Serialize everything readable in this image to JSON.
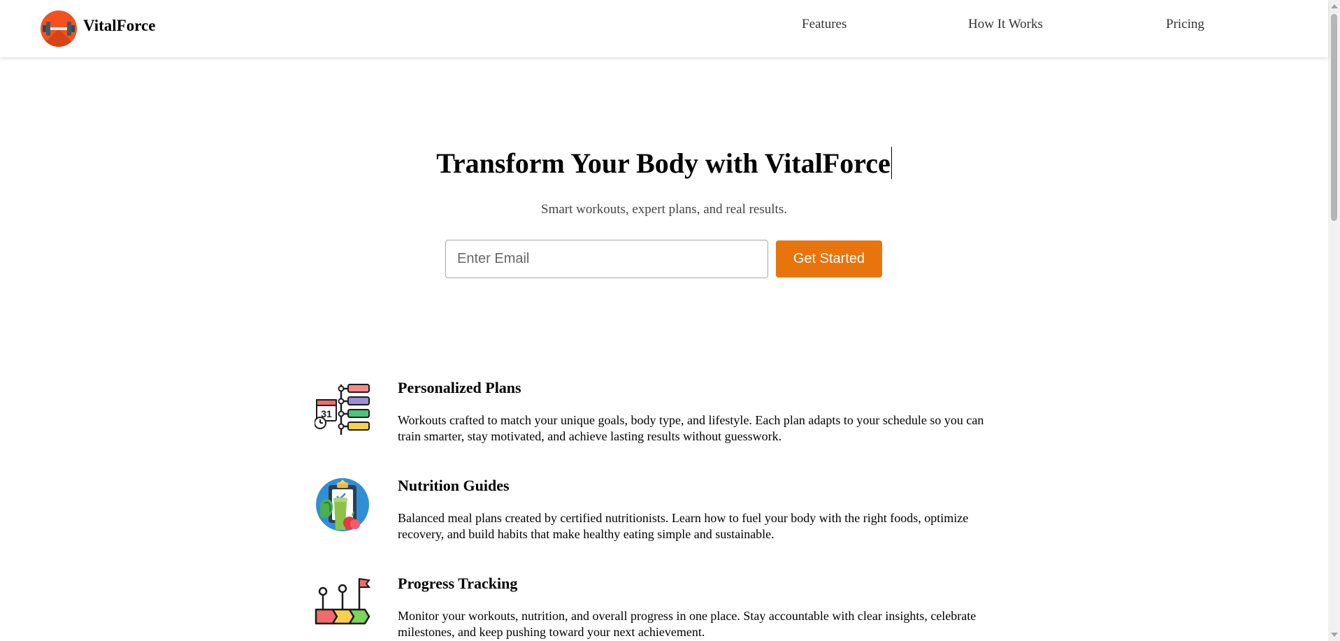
{
  "header": {
    "brand": "VitalForce",
    "logo_icon": "dumbbell-icon",
    "nav": [
      {
        "label": "Features"
      },
      {
        "label": "How It Works"
      },
      {
        "label": "Pricing"
      }
    ]
  },
  "hero": {
    "title": "Transform Your Body with VitalForce",
    "subtitle": "Smart workouts, expert plans, and real results.",
    "email_placeholder": "Enter Email",
    "email_value": "",
    "cta_label": "Get Started"
  },
  "features": [
    {
      "icon": "schedule-plan-icon",
      "title": "Personalized Plans",
      "description": "Workouts crafted to match your unique goals, body type, and lifestyle. Each plan adapts to your schedule so you can train smarter, stay motivated, and achieve lasting results without guesswork."
    },
    {
      "icon": "nutrition-clipboard-icon",
      "title": "Nutrition Guides",
      "description": "Balanced meal plans created by certified nutritionists. Learn how to fuel your body with the right foods, optimize recovery, and build habits that make healthy eating simple and sustainable."
    },
    {
      "icon": "progress-milestone-icon",
      "title": "Progress Tracking",
      "description": "Monitor your workouts, nutrition, and overall progress in one place. Stay accountable with clear insights, celebrate milestones, and keep pushing toward your next achievement."
    }
  ],
  "colors": {
    "accent": "#e8740d",
    "logo": "#f4511e"
  }
}
